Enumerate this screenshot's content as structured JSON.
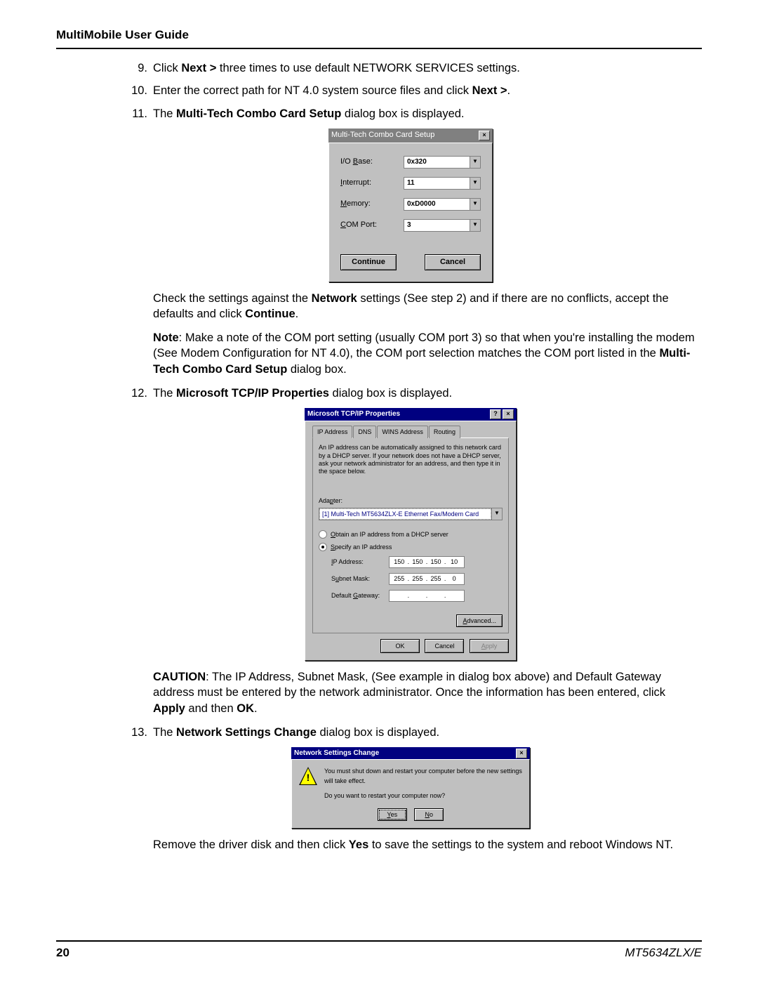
{
  "header": {
    "title": "MultiMobile User Guide"
  },
  "steps": {
    "s9": {
      "num": "9.",
      "p1a": "Click ",
      "p1b": "Next > ",
      "p1c": "three times to use default NETWORK SERVICES settings."
    },
    "s10": {
      "num": "10.",
      "p1a": "Enter the correct path for NT 4.0 system source files and click ",
      "p1b": "Next >",
      "p1c": "."
    },
    "s11": {
      "num": "11.",
      "p1a": "The ",
      "p1b": "Multi-Tech Combo Card Setup",
      "p1c": " dialog box is displayed."
    },
    "s11b": {
      "a": "Check the settings against the ",
      "b": "Network",
      "c": " settings (See step 2) and if there are no conflicts, accept the defaults and click ",
      "d": "Continue",
      "e": "."
    },
    "s11c": {
      "a": "Note",
      "b": ": Make a note of the COM port setting (usually COM port 3) so that when you're installing the modem (See Modem Configuration for NT 4.0), the COM port selection matches the COM port listed in the ",
      "c": "Multi-Tech Combo Card Setup",
      "d": " dialog box."
    },
    "s12": {
      "num": "12.",
      "a": "The ",
      "b": "Microsoft TCP/IP Properties",
      "c": " dialog box is displayed."
    },
    "s12b": {
      "a": "CAUTION",
      "b": ": The IP Address, Subnet Mask, (See example in dialog box above) and Default Gateway address must be entered by the network administrator. Once the information has been entered, click ",
      "c": "Apply",
      "d": " and then ",
      "e": "OK",
      "f": "."
    },
    "s13": {
      "num": "13.",
      "a": "The ",
      "b": "Network Settings Change",
      "c": " dialog box is displayed."
    },
    "s13b": {
      "a": "Remove the driver disk and then click ",
      "b": "Yes",
      "c": " to save the settings to the system and reboot Windows NT."
    }
  },
  "dlg1": {
    "title": "Multi-Tech Combo Card Setup",
    "rows": {
      "io": {
        "labelPre": "I/O ",
        "labelU": "B",
        "labelPost": "ase:",
        "value": "0x320"
      },
      "int": {
        "labelU": "I",
        "labelPost": "nterrupt:",
        "value": "11"
      },
      "mem": {
        "labelU": "M",
        "labelPost": "emory:",
        "value": "0xD0000"
      },
      "com": {
        "labelU": "C",
        "labelPost": "OM Port:",
        "value": "3"
      }
    },
    "buttons": {
      "continue": "Continue",
      "cancel": "Cancel"
    }
  },
  "dlg2": {
    "title": "Microsoft TCP/IP Properties",
    "tabs": {
      "t1": "IP Address",
      "t2": "DNS",
      "t3": "WINS Address",
      "t4": "Routing"
    },
    "desc": "An IP address can be automatically assigned to this network card by a DHCP server.  If your network does not have a DHCP server, ask your network administrator for an address, and then type it in the space below.",
    "adapterLabelA": "Ada",
    "adapterLabelU": "p",
    "adapterLabelB": "ter:",
    "adapterValue": "[1] Multi-Tech MT5634ZLX-E Ethernet Fax/Modem Card",
    "radio1a": "O",
    "radio1b": "btain an IP address from a DHCP server",
    "radio2a": "S",
    "radio2b": "pecify an IP address",
    "ipLabelA": "I",
    "ipLabelB": "P Address:",
    "ipValue": {
      "o1": "150",
      "o2": "150",
      "o3": "150",
      "o4": "10"
    },
    "smLabelA": "S",
    "smLabelU": "u",
    "smLabelB": "bnet Mask:",
    "smValue": {
      "o1": "255",
      "o2": "255",
      "o3": "255",
      "o4": "0"
    },
    "gwLabelA": "Default ",
    "gwLabelU": "G",
    "gwLabelB": "ateway:",
    "advU": "A",
    "advRest": "dvanced...",
    "buttons": {
      "ok": "OK",
      "cancel": "Cancel",
      "applyU": "A",
      "applyRest": "pply"
    }
  },
  "dlg3": {
    "title": "Network Settings Change",
    "line1": "You must shut down and restart your computer before the new settings will take effect.",
    "line2": "Do you want to restart your computer now?",
    "yesU": "Y",
    "yesRest": "es",
    "noU": "N",
    "noRest": "o"
  },
  "footer": {
    "page": "20",
    "model": "MT5634ZLX/E"
  }
}
